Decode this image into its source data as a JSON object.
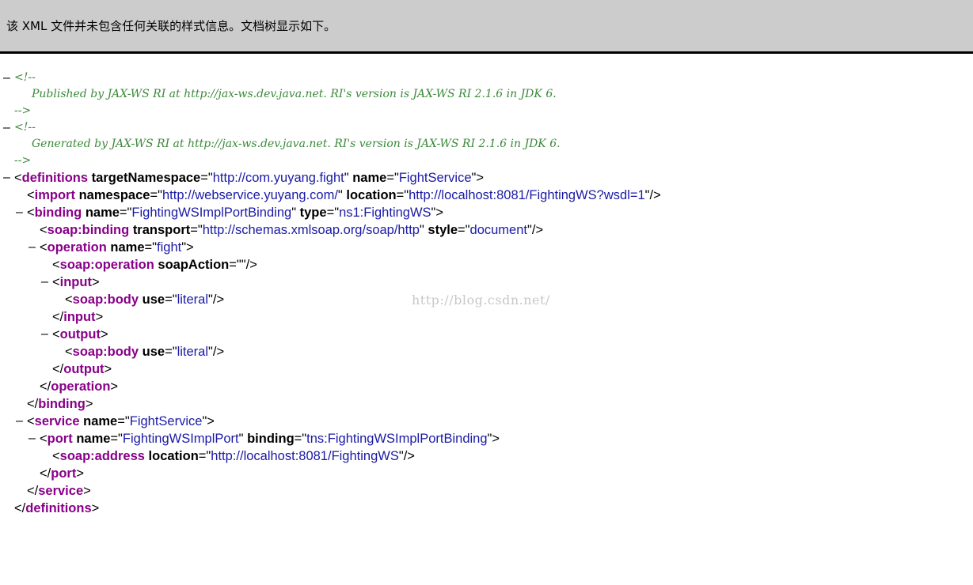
{
  "info_bar": {
    "message": "该 XML 文件并未包含任何关联的样式信息。文档树显示如下。"
  },
  "toggle_symbol": "–",
  "comments": [
    {
      "open": "<!--",
      "text": "Published by JAX-WS RI at http://jax-ws.dev.java.net. RI's version is JAX-WS RI 2.1.6 in JDK 6.",
      "close": "-->"
    },
    {
      "open": "<!--",
      "text": "Generated by JAX-WS RI at http://jax-ws.dev.java.net. RI's version is JAX-WS RI 2.1.6 in JDK 6.",
      "close": "-->"
    }
  ],
  "tags": {
    "definitions": "definitions",
    "import": "import",
    "binding": "binding",
    "soap_binding": "soap:binding",
    "operation": "operation",
    "soap_operation": "soap:operation",
    "input": "input",
    "soap_body": "soap:body",
    "output": "output",
    "service": "service",
    "port": "port",
    "soap_address": "soap:address"
  },
  "attrs": {
    "definitions": [
      {
        "name": "targetNamespace",
        "value": "http://com.yuyang.fight"
      },
      {
        "name": "name",
        "value": "FightService"
      }
    ],
    "import": [
      {
        "name": "namespace",
        "value": "http://webservice.yuyang.com/"
      },
      {
        "name": "location",
        "value": "http://localhost:8081/FightingWS?wsdl=1"
      }
    ],
    "binding": [
      {
        "name": "name",
        "value": "FightingWSImplPortBinding"
      },
      {
        "name": "type",
        "value": "ns1:FightingWS"
      }
    ],
    "soap_binding": [
      {
        "name": "transport",
        "value": "http://schemas.xmlsoap.org/soap/http"
      },
      {
        "name": "style",
        "value": "document"
      }
    ],
    "operation": [
      {
        "name": "name",
        "value": "fight"
      }
    ],
    "soap_operation": [
      {
        "name": "soapAction",
        "value": ""
      }
    ],
    "soap_body_input": [
      {
        "name": "use",
        "value": "literal"
      }
    ],
    "soap_body_output": [
      {
        "name": "use",
        "value": "literal"
      }
    ],
    "service": [
      {
        "name": "name",
        "value": "FightService"
      }
    ],
    "port": [
      {
        "name": "name",
        "value": "FightingWSImplPort"
      },
      {
        "name": "binding",
        "value": "tns:FightingWSImplPortBinding"
      }
    ],
    "soap_address": [
      {
        "name": "location",
        "value": "http://localhost:8081/FightingWS"
      }
    ]
  },
  "watermark": "http://blog.csdn.net/",
  "colors": {
    "info_bar_bg": "#cccccc",
    "tag_name": "#880088",
    "attr_value": "#1a1aa6",
    "comment": "#3a8a3a"
  }
}
